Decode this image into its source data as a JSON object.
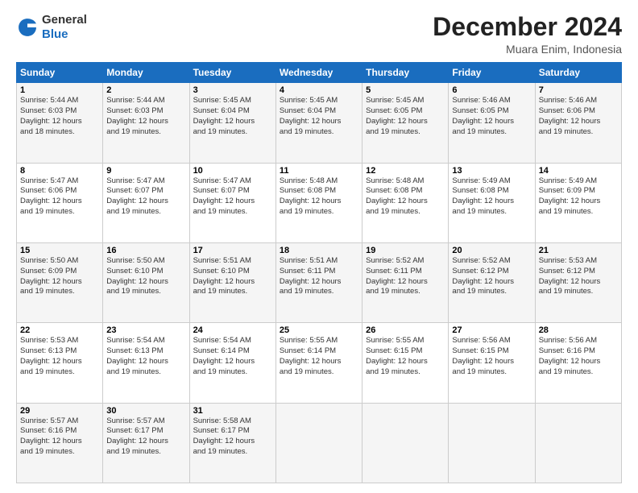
{
  "logo": {
    "general": "General",
    "blue": "Blue"
  },
  "header": {
    "month": "December 2024",
    "location": "Muara Enim, Indonesia"
  },
  "weekdays": [
    "Sunday",
    "Monday",
    "Tuesday",
    "Wednesday",
    "Thursday",
    "Friday",
    "Saturday"
  ],
  "weeks": [
    [
      {
        "day": "1",
        "sunrise": "5:44 AM",
        "sunset": "6:03 PM",
        "daylight": "12 hours and 18 minutes."
      },
      {
        "day": "2",
        "sunrise": "5:44 AM",
        "sunset": "6:03 PM",
        "daylight": "12 hours and 19 minutes."
      },
      {
        "day": "3",
        "sunrise": "5:45 AM",
        "sunset": "6:04 PM",
        "daylight": "12 hours and 19 minutes."
      },
      {
        "day": "4",
        "sunrise": "5:45 AM",
        "sunset": "6:04 PM",
        "daylight": "12 hours and 19 minutes."
      },
      {
        "day": "5",
        "sunrise": "5:45 AM",
        "sunset": "6:05 PM",
        "daylight": "12 hours and 19 minutes."
      },
      {
        "day": "6",
        "sunrise": "5:46 AM",
        "sunset": "6:05 PM",
        "daylight": "12 hours and 19 minutes."
      },
      {
        "day": "7",
        "sunrise": "5:46 AM",
        "sunset": "6:06 PM",
        "daylight": "12 hours and 19 minutes."
      }
    ],
    [
      {
        "day": "8",
        "sunrise": "5:47 AM",
        "sunset": "6:06 PM",
        "daylight": "12 hours and 19 minutes."
      },
      {
        "day": "9",
        "sunrise": "5:47 AM",
        "sunset": "6:07 PM",
        "daylight": "12 hours and 19 minutes."
      },
      {
        "day": "10",
        "sunrise": "5:47 AM",
        "sunset": "6:07 PM",
        "daylight": "12 hours and 19 minutes."
      },
      {
        "day": "11",
        "sunrise": "5:48 AM",
        "sunset": "6:08 PM",
        "daylight": "12 hours and 19 minutes."
      },
      {
        "day": "12",
        "sunrise": "5:48 AM",
        "sunset": "6:08 PM",
        "daylight": "12 hours and 19 minutes."
      },
      {
        "day": "13",
        "sunrise": "5:49 AM",
        "sunset": "6:08 PM",
        "daylight": "12 hours and 19 minutes."
      },
      {
        "day": "14",
        "sunrise": "5:49 AM",
        "sunset": "6:09 PM",
        "daylight": "12 hours and 19 minutes."
      }
    ],
    [
      {
        "day": "15",
        "sunrise": "5:50 AM",
        "sunset": "6:09 PM",
        "daylight": "12 hours and 19 minutes."
      },
      {
        "day": "16",
        "sunrise": "5:50 AM",
        "sunset": "6:10 PM",
        "daylight": "12 hours and 19 minutes."
      },
      {
        "day": "17",
        "sunrise": "5:51 AM",
        "sunset": "6:10 PM",
        "daylight": "12 hours and 19 minutes."
      },
      {
        "day": "18",
        "sunrise": "5:51 AM",
        "sunset": "6:11 PM",
        "daylight": "12 hours and 19 minutes."
      },
      {
        "day": "19",
        "sunrise": "5:52 AM",
        "sunset": "6:11 PM",
        "daylight": "12 hours and 19 minutes."
      },
      {
        "day": "20",
        "sunrise": "5:52 AM",
        "sunset": "6:12 PM",
        "daylight": "12 hours and 19 minutes."
      },
      {
        "day": "21",
        "sunrise": "5:53 AM",
        "sunset": "6:12 PM",
        "daylight": "12 hours and 19 minutes."
      }
    ],
    [
      {
        "day": "22",
        "sunrise": "5:53 AM",
        "sunset": "6:13 PM",
        "daylight": "12 hours and 19 minutes."
      },
      {
        "day": "23",
        "sunrise": "5:54 AM",
        "sunset": "6:13 PM",
        "daylight": "12 hours and 19 minutes."
      },
      {
        "day": "24",
        "sunrise": "5:54 AM",
        "sunset": "6:14 PM",
        "daylight": "12 hours and 19 minutes."
      },
      {
        "day": "25",
        "sunrise": "5:55 AM",
        "sunset": "6:14 PM",
        "daylight": "12 hours and 19 minutes."
      },
      {
        "day": "26",
        "sunrise": "5:55 AM",
        "sunset": "6:15 PM",
        "daylight": "12 hours and 19 minutes."
      },
      {
        "day": "27",
        "sunrise": "5:56 AM",
        "sunset": "6:15 PM",
        "daylight": "12 hours and 19 minutes."
      },
      {
        "day": "28",
        "sunrise": "5:56 AM",
        "sunset": "6:16 PM",
        "daylight": "12 hours and 19 minutes."
      }
    ],
    [
      {
        "day": "29",
        "sunrise": "5:57 AM",
        "sunset": "6:16 PM",
        "daylight": "12 hours and 19 minutes."
      },
      {
        "day": "30",
        "sunrise": "5:57 AM",
        "sunset": "6:17 PM",
        "daylight": "12 hours and 19 minutes."
      },
      {
        "day": "31",
        "sunrise": "5:58 AM",
        "sunset": "6:17 PM",
        "daylight": "12 hours and 19 minutes."
      },
      null,
      null,
      null,
      null
    ]
  ]
}
